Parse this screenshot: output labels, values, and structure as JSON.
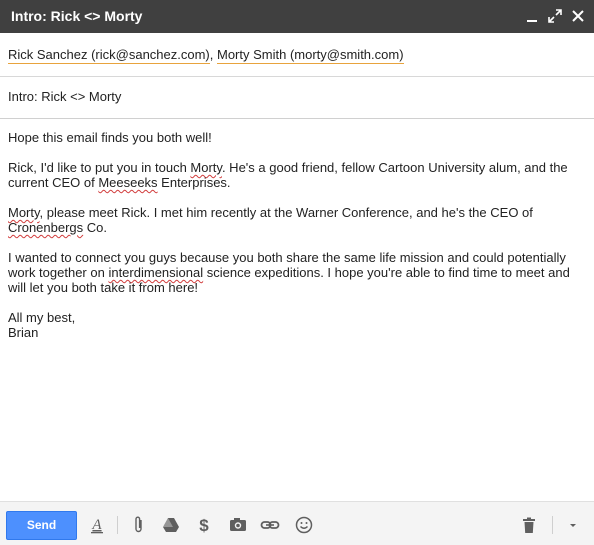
{
  "window": {
    "title": "Intro: Rick <> Morty"
  },
  "recipients": {
    "to": [
      "Rick Sanchez (rick@sanchez.com)",
      "Morty Smith (morty@smith.com)"
    ],
    "separator": ", "
  },
  "subject": "Intro: Rick <> Morty",
  "body": {
    "greeting": "Hope this email finds you both well!",
    "p1": {
      "a": "Rick, I'd like to put you in touch ",
      "morty": "Morty",
      "b": ". He's a good friend, fellow Cartoon University alum, and the current CEO of ",
      "meeseeks": "Meeseeks",
      "c": " Enterprises."
    },
    "p2": {
      "morty": "Morty",
      "a": ", please meet Rick. I met him recently at the Warner Conference, and he's the CEO of ",
      "cronenbergs": "Cronenbergs",
      "b": " Co."
    },
    "p3": {
      "a": "I wanted to connect you guys because you both share the same life mission and could potentially work together on ",
      "interdimensional": "interdimensional",
      "b": " science expeditions. I hope you're able to find time to meet and will let you both take it from here!"
    },
    "signoff": "All my best,",
    "signature": "Brian"
  },
  "toolbar": {
    "send_label": "Send",
    "icons": [
      "formatting-icon",
      "attach-icon",
      "drive-icon",
      "money-icon",
      "photo-icon",
      "link-icon",
      "emoji-icon",
      "trash-icon",
      "more-options-icon"
    ]
  },
  "colors": {
    "titlebar": "#404040",
    "send_button": "#4d90fe",
    "recipient_underline": "#e8a33d",
    "spellcheck_underline": "#d13b3b"
  }
}
